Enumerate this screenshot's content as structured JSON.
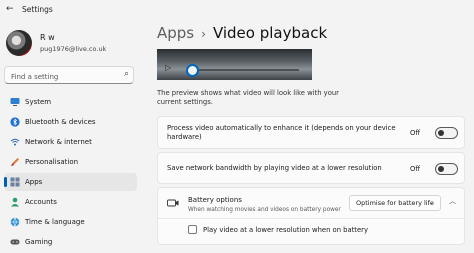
{
  "window": {
    "title": "Settings"
  },
  "profile": {
    "name": "R w",
    "email": "pug1976@live.co.uk"
  },
  "search": {
    "placeholder": "Find a setting"
  },
  "sidebar": {
    "items": [
      {
        "label": "System",
        "icon": "monitor-icon"
      },
      {
        "label": "Bluetooth & devices",
        "icon": "bluetooth-icon"
      },
      {
        "label": "Network & internet",
        "icon": "wifi-icon"
      },
      {
        "label": "Personalisation",
        "icon": "brush-icon"
      },
      {
        "label": "Apps",
        "icon": "apps-icon",
        "active": true
      },
      {
        "label": "Accounts",
        "icon": "person-icon"
      },
      {
        "label": "Time & language",
        "icon": "globe-icon"
      },
      {
        "label": "Gaming",
        "icon": "gamepad-icon"
      }
    ]
  },
  "breadcrumb": {
    "parent": "Apps",
    "separator": "›",
    "current": "Video playback"
  },
  "preview": {
    "description": "The preview shows what video will look like with your current settings."
  },
  "settings": {
    "enhance": {
      "label": "Process video automatically to enhance it (depends on your device hardware)",
      "state": "Off"
    },
    "bandwidth": {
      "label": "Save network bandwidth by playing video at a lower resolution",
      "state": "Off"
    },
    "battery": {
      "title": "Battery options",
      "subtitle": "When watching movies and videos on battery power",
      "selected": "Optimise for battery life",
      "checkbox_label": "Play video at a lower resolution when on battery"
    }
  },
  "colors": {
    "accent": "#005fb8",
    "background": "#f3f3f3",
    "card": "#fbfbfb"
  }
}
